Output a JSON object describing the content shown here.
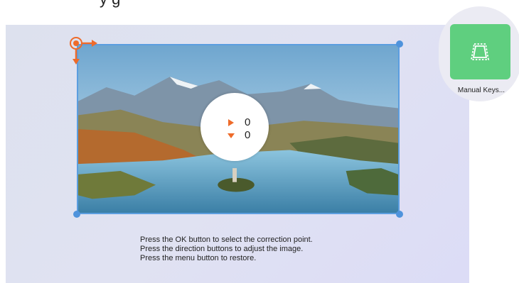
{
  "header": {
    "partial_text": "y         g"
  },
  "keystone": {
    "horizontal_value": "0",
    "vertical_value": "0",
    "accent_color": "#ee6b2a",
    "frame_color": "#5b9ee0"
  },
  "instructions": {
    "line1": "Press the OK button to select the correction point.",
    "line2": "Press the direction buttons to adjust the image.",
    "line3": "Press the menu button to restore."
  },
  "side_app": {
    "label": "Manual Keys...",
    "icon": "keystone-trapezoid-icon",
    "tile_color": "#5fcf7f"
  }
}
